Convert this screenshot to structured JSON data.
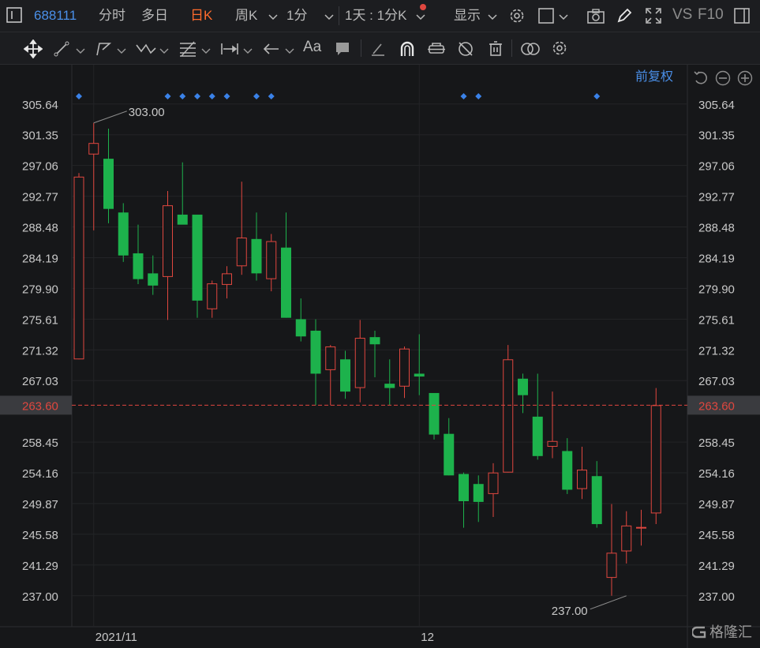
{
  "topbar": {
    "code": "688111",
    "tabs": [
      "分时",
      "多日",
      "日K",
      "周K",
      "1分"
    ],
    "active_tab": "日K",
    "interval_label": "1天 : 1分K",
    "display_label": "显示",
    "vs_label": "VS",
    "f10_label": "F10"
  },
  "toolbar": {
    "icons": [
      "move-icon",
      "line-icon",
      "polyline-icon",
      "wave-icon",
      "fibonacci-icon",
      "measure-icon",
      "arrow-icon",
      "text-icon",
      "comment-icon",
      "eraser-icon",
      "magnet-icon",
      "lock-icon",
      "hide-icon",
      "delete-icon",
      "overlay-icon",
      "settings-icon"
    ],
    "text_tool_label": "Aa"
  },
  "chart_header": {
    "adjust_label": "前复权"
  },
  "colors": {
    "up": "#e0473f",
    "down": "#1db24c",
    "last_price_line": "#e0473f",
    "marker": "#3a82e8",
    "active_tab": "#ff6b2c",
    "link": "#4a8fe8"
  },
  "chart_data": {
    "type": "candlestick",
    "ylim": [
      235.0,
      307.8
    ],
    "y_ticks": [
      "305.64",
      "301.35",
      "297.06",
      "292.77",
      "288.48",
      "284.19",
      "279.90",
      "275.61",
      "271.32",
      "267.03",
      "258.45",
      "254.16",
      "249.87",
      "245.58",
      "241.29",
      "237.00"
    ],
    "last_price": "263.60",
    "x_labels": [
      {
        "index": 1,
        "label": "2021/11"
      },
      {
        "index": 23,
        "label": "12"
      }
    ],
    "max_label": {
      "index": 1,
      "value": "303.00"
    },
    "min_label": {
      "index": 37,
      "value": "237.00"
    },
    "markers": [
      0,
      6,
      7,
      8,
      9,
      10,
      12,
      13,
      26,
      27,
      35
    ],
    "candles": [
      {
        "o": 270.0,
        "h": 296.0,
        "l": 270.0,
        "c": 295.5
      },
      {
        "o": 298.6,
        "h": 303.0,
        "l": 288.0,
        "c": 300.2
      },
      {
        "o": 298.0,
        "h": 302.2,
        "l": 289.0,
        "c": 291.0
      },
      {
        "o": 290.5,
        "h": 291.8,
        "l": 283.6,
        "c": 284.5
      },
      {
        "o": 284.8,
        "h": 288.8,
        "l": 280.5,
        "c": 281.2
      },
      {
        "o": 282.0,
        "h": 284.5,
        "l": 279.0,
        "c": 280.3
      },
      {
        "o": 281.5,
        "h": 293.5,
        "l": 275.5,
        "c": 291.5
      },
      {
        "o": 290.2,
        "h": 297.5,
        "l": 289.0,
        "c": 288.8
      },
      {
        "o": 290.2,
        "h": 290.2,
        "l": 275.8,
        "c": 278.2
      },
      {
        "o": 277.0,
        "h": 281.0,
        "l": 275.8,
        "c": 280.6
      },
      {
        "o": 280.4,
        "h": 283.0,
        "l": 278.5,
        "c": 282.0
      },
      {
        "o": 283.0,
        "h": 294.8,
        "l": 281.8,
        "c": 287.0
      },
      {
        "o": 286.8,
        "h": 290.5,
        "l": 281.0,
        "c": 282.0
      },
      {
        "o": 281.2,
        "h": 287.5,
        "l": 279.5,
        "c": 286.5
      },
      {
        "o": 285.6,
        "h": 290.5,
        "l": 275.8,
        "c": 275.8
      },
      {
        "o": 275.6,
        "h": 278.5,
        "l": 272.5,
        "c": 273.2
      },
      {
        "o": 274.0,
        "h": 275.6,
        "l": 263.6,
        "c": 268.0
      },
      {
        "o": 268.5,
        "h": 272.0,
        "l": 263.6,
        "c": 271.8
      },
      {
        "o": 270.0,
        "h": 271.2,
        "l": 264.5,
        "c": 265.5
      },
      {
        "o": 266.0,
        "h": 275.5,
        "l": 264.0,
        "c": 273.0
      },
      {
        "o": 273.1,
        "h": 274.0,
        "l": 267.5,
        "c": 272.1
      },
      {
        "o": 266.6,
        "h": 270.0,
        "l": 263.6,
        "c": 266.0
      },
      {
        "o": 266.2,
        "h": 271.8,
        "l": 264.6,
        "c": 271.5
      },
      {
        "o": 268.0,
        "h": 273.5,
        "l": 265.0,
        "c": 267.6
      },
      {
        "o": 265.3,
        "h": 265.3,
        "l": 258.8,
        "c": 259.5
      },
      {
        "o": 259.6,
        "h": 261.8,
        "l": 253.8,
        "c": 253.8
      },
      {
        "o": 254.0,
        "h": 254.2,
        "l": 246.5,
        "c": 250.2
      },
      {
        "o": 252.6,
        "h": 253.8,
        "l": 247.3,
        "c": 250.1
      },
      {
        "o": 251.2,
        "h": 255.5,
        "l": 248.0,
        "c": 254.2
      },
      {
        "o": 254.2,
        "h": 272.0,
        "l": 254.2,
        "c": 270.0
      },
      {
        "o": 267.3,
        "h": 268.0,
        "l": 262.5,
        "c": 265.0
      },
      {
        "o": 262.0,
        "h": 268.0,
        "l": 256.0,
        "c": 256.5
      },
      {
        "o": 257.8,
        "h": 265.5,
        "l": 256.2,
        "c": 258.6
      },
      {
        "o": 257.2,
        "h": 259.0,
        "l": 251.2,
        "c": 251.8
      },
      {
        "o": 251.9,
        "h": 257.8,
        "l": 250.5,
        "c": 254.6
      },
      {
        "o": 253.7,
        "h": 255.8,
        "l": 246.5,
        "c": 247.0
      },
      {
        "o": 239.5,
        "h": 249.8,
        "l": 237.0,
        "c": 243.0
      },
      {
        "o": 243.2,
        "h": 248.8,
        "l": 241.5,
        "c": 246.8
      },
      {
        "o": 246.5,
        "h": 249.0,
        "l": 244.0,
        "c": 246.6
      },
      {
        "o": 248.5,
        "h": 266.0,
        "l": 247.0,
        "c": 263.6
      }
    ]
  },
  "watermark": "格隆汇"
}
